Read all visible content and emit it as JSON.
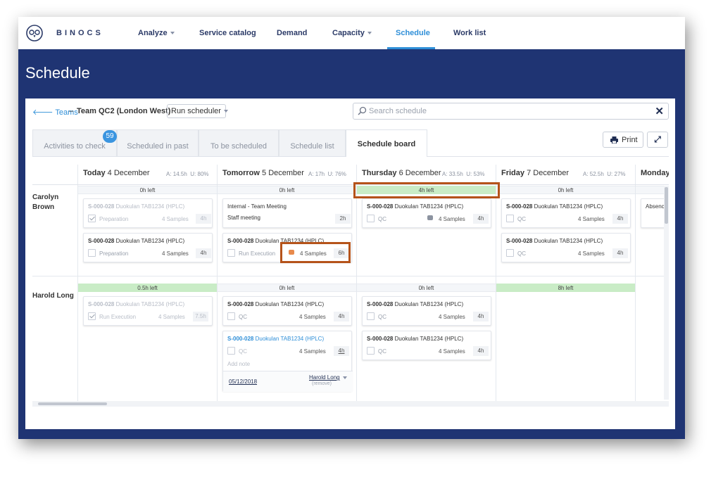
{
  "nav": {
    "brand": "BINOCS",
    "items": [
      {
        "label": "Analyze",
        "dropdown": true
      },
      {
        "label": "Service catalog",
        "dropdown": false
      },
      {
        "label": "Demand",
        "dropdown": false
      },
      {
        "label": "Capacity",
        "dropdown": true
      },
      {
        "label": "Schedule",
        "dropdown": false,
        "active": true
      },
      {
        "label": "Work list",
        "dropdown": false
      }
    ]
  },
  "page": {
    "title": "Schedule"
  },
  "toolbar": {
    "back_label": "Teams",
    "separator": "–",
    "team_name": "Team QC2 (London West)",
    "run_scheduler_label": "Run scheduler",
    "search_placeholder": "Search schedule",
    "print_label": "Print"
  },
  "tabs": [
    {
      "label": "Activities to check",
      "badge": "59"
    },
    {
      "label": "Scheduled in past"
    },
    {
      "label": "To be scheduled"
    },
    {
      "label": "Schedule list"
    },
    {
      "label": "Schedule board",
      "active": true
    }
  ],
  "days": [
    {
      "prefix": "Today",
      "date": "4 December",
      "a": "A: 14.5h",
      "u": "U: 80%"
    },
    {
      "prefix": "Tomorrow",
      "date": "5 December",
      "a": "A: 17h",
      "u": "U: 76%"
    },
    {
      "prefix": "Thursday",
      "date": "6 December",
      "a": "A: 33.5h",
      "u": "U: 53%"
    },
    {
      "prefix": "Friday",
      "date": "7 December",
      "a": "A: 52.5h",
      "u": "U: 27%"
    },
    {
      "prefix": "Monday",
      "date": "",
      "a": "",
      "u": ""
    }
  ],
  "people": [
    {
      "name": "Carolyn Brown",
      "capacity": [
        "0h left",
        "0h left",
        "4h left",
        "0h left"
      ],
      "cards": [
        [
          {
            "id": "S-000-028",
            "product": "Duokulan TAB1234 (HPLC)",
            "activity": "Preparation",
            "samples": "4 Samples",
            "hours": "4h",
            "faded": true,
            "checked": true
          },
          {
            "id": "S-000-028",
            "product": "Duokulan TAB1234 (HPLC)",
            "activity": "Preparation",
            "samples": "4 Samples",
            "hours": "4h"
          }
        ],
        [
          {
            "line1": "Internal - Team Meeting",
            "line2": "Staff meeting",
            "hours": "2h"
          },
          {
            "id": "S-000-028",
            "product": "Duokulan TAB1234 (HPLC)",
            "activity": "Run Execution",
            "samples": "4 Samples",
            "hours": "6h",
            "comment": true
          }
        ],
        [
          {
            "id": "S-000-028",
            "product": "Duokulan TAB1234 (HPLC)",
            "activity": "QC",
            "samples": "4 Samples",
            "hours": "4h",
            "comment": true
          }
        ],
        [
          {
            "id": "S-000-028",
            "product": "Duokulan TAB1234 (HPLC)",
            "activity": "QC",
            "samples": "4 Samples",
            "hours": "4h"
          },
          {
            "id": "S-000-028",
            "product": "Duokulan TAB1234 (HPLC)",
            "activity": "QC",
            "samples": "4 Samples",
            "hours": "4h"
          }
        ],
        [
          {
            "line1": "Absenc"
          }
        ]
      ]
    },
    {
      "name": "Harold Long",
      "capacity": [
        "0.5h left",
        "0h left",
        "0h left",
        "8h left"
      ],
      "cards": [
        [
          {
            "id": "S-000-028",
            "product": "Duokulan TAB1234 (HPLC)",
            "activity": "Run Execution",
            "samples": "4 Samples",
            "hours": "7.5h",
            "faded": true,
            "checked": true
          }
        ],
        [
          {
            "id": "S-000-028",
            "product": "Duokulan TAB1234 (HPLC)",
            "activity": "QC",
            "samples": "4 Samples",
            "hours": "4h"
          },
          {
            "id": "S-000-028",
            "product": "Duokulan TAB1234 (HPLC)",
            "activity": "QC",
            "samples": "4 Samples",
            "hours": "4h",
            "add_note": "Add note",
            "date": "05/12/2018",
            "assignee": "Harold Long",
            "remove": "(remove)"
          }
        ],
        [
          {
            "id": "S-000-028",
            "product": "Duokulan TAB1234 (HPLC)",
            "activity": "QC",
            "samples": "4 Samples",
            "hours": "4h"
          },
          {
            "id": "S-000-028",
            "product": "Duokulan TAB1234 (HPLC)",
            "activity": "QC",
            "samples": "4 Samples",
            "hours": "4h"
          }
        ]
      ]
    }
  ],
  "colors": {
    "navy": "#1f3473",
    "accent": "#2f8fd8",
    "capacity_green": "#c9ecc6",
    "highlight": "#b5531a",
    "comment_orange": "#e88a4c"
  }
}
